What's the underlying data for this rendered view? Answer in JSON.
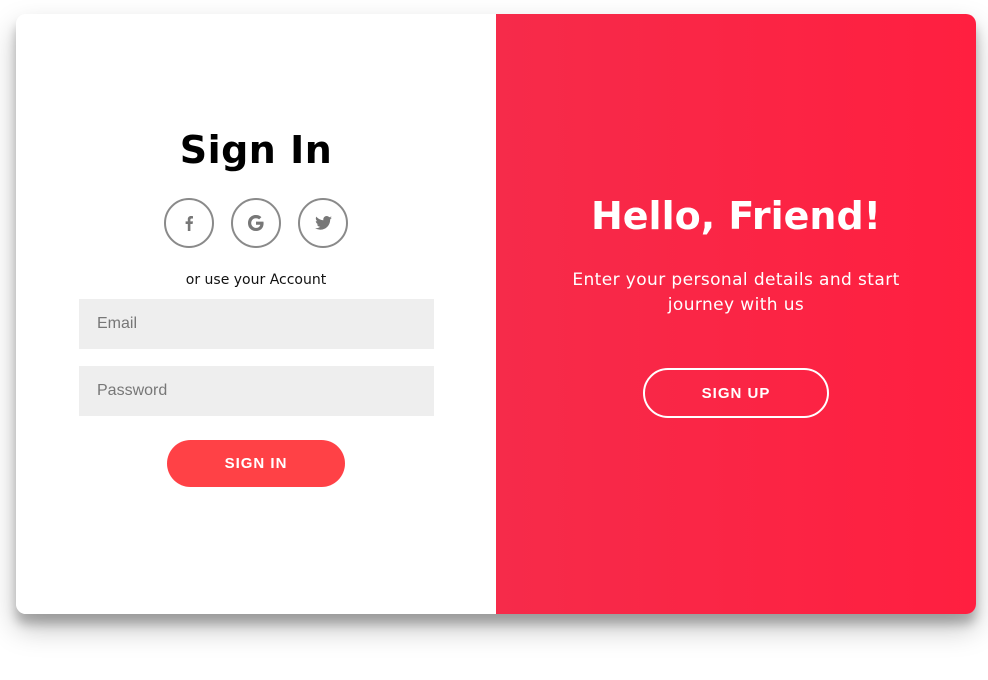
{
  "sign_in_panel": {
    "title": "Sign In",
    "social_buttons": [
      {
        "icon": "facebook-icon",
        "glyph": "f"
      },
      {
        "icon": "google-icon",
        "glyph": "G"
      },
      {
        "icon": "twitter-icon",
        "glyph": ""
      }
    ],
    "sub_text": "or use your Account",
    "email_placeholder": "Email",
    "password_placeholder": "Password",
    "submit_label": "SIGN IN"
  },
  "overlay_panel": {
    "title": "Hello, Friend!",
    "description": "Enter your personal details and start journey with us",
    "button_label": "SIGN UP"
  },
  "colors": {
    "accent": "#ff4146",
    "panel_gradient_start": "#f62b4a",
    "panel_gradient_end": "#ff1f40",
    "input_bg": "#eeeeee",
    "social_border": "#8a8a8a"
  }
}
